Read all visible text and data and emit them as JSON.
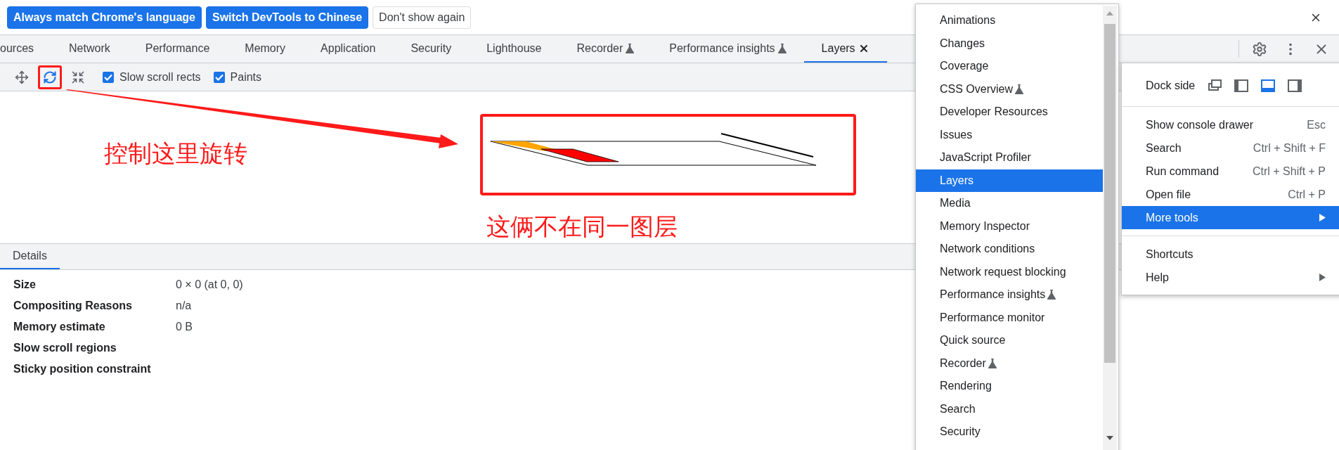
{
  "infobar": {
    "buttons": [
      {
        "label": "Always match Chrome's language",
        "kind": "primary"
      },
      {
        "label": "Switch DevTools to Chinese",
        "kind": "primary"
      },
      {
        "label": "Don't show again",
        "kind": "secondary"
      }
    ]
  },
  "tabs": [
    {
      "label": "ources",
      "selected": false,
      "experimental": false,
      "closable": false
    },
    {
      "label": "Network",
      "selected": false,
      "experimental": false,
      "closable": false
    },
    {
      "label": "Performance",
      "selected": false,
      "experimental": false,
      "closable": false
    },
    {
      "label": "Memory",
      "selected": false,
      "experimental": false,
      "closable": false
    },
    {
      "label": "Application",
      "selected": false,
      "experimental": false,
      "closable": false
    },
    {
      "label": "Security",
      "selected": false,
      "experimental": false,
      "closable": false
    },
    {
      "label": "Lighthouse",
      "selected": false,
      "experimental": false,
      "closable": false
    },
    {
      "label": "Recorder",
      "selected": false,
      "experimental": true,
      "closable": false
    },
    {
      "label": "Performance insights",
      "selected": false,
      "experimental": true,
      "closable": false
    },
    {
      "label": "Layers",
      "selected": true,
      "experimental": false,
      "closable": true
    }
  ],
  "toolbar": {
    "tools": [
      {
        "kind": "pan",
        "selected": false,
        "annotated": false
      },
      {
        "kind": "rotate",
        "selected": true,
        "annotated": true
      },
      {
        "kind": "reset",
        "selected": false,
        "annotated": false
      }
    ],
    "checkboxes": [
      {
        "label": "Slow scroll rects",
        "checked": true
      },
      {
        "label": "Paints",
        "checked": true
      }
    ]
  },
  "annotations": [
    {
      "text": "控制这里旋转"
    },
    {
      "text": "这俩不在同一图层"
    }
  ],
  "details": {
    "tab": {
      "label": "Details",
      "selected": true
    },
    "rows": [
      {
        "label": "Size",
        "value": "0 × 0 (at 0, 0)"
      },
      {
        "label": "Compositing Reasons",
        "value": "n/a"
      },
      {
        "label": "Memory estimate",
        "value": "0 B"
      },
      {
        "label": "Slow scroll regions"
      },
      {
        "label": "Sticky position constraint"
      }
    ]
  },
  "more_tools_menu": {
    "items": [
      {
        "label": "Animations",
        "experimental": false,
        "selected": false
      },
      {
        "label": "Changes",
        "experimental": false,
        "selected": false
      },
      {
        "label": "Coverage",
        "experimental": false,
        "selected": false
      },
      {
        "label": "CSS Overview",
        "experimental": true,
        "selected": false
      },
      {
        "label": "Developer Resources",
        "experimental": false,
        "selected": false
      },
      {
        "label": "Issues",
        "experimental": false,
        "selected": false
      },
      {
        "label": "JavaScript Profiler",
        "experimental": false,
        "selected": false
      },
      {
        "label": "Layers",
        "experimental": false,
        "selected": true
      },
      {
        "label": "Media",
        "experimental": false,
        "selected": false
      },
      {
        "label": "Memory Inspector",
        "experimental": false,
        "selected": false
      },
      {
        "label": "Network conditions",
        "experimental": false,
        "selected": false
      },
      {
        "label": "Network request blocking",
        "experimental": false,
        "selected": false
      },
      {
        "label": "Performance insights",
        "experimental": true,
        "selected": false
      },
      {
        "label": "Performance monitor",
        "experimental": false,
        "selected": false
      },
      {
        "label": "Quick source",
        "experimental": false,
        "selected": false
      },
      {
        "label": "Recorder",
        "experimental": true,
        "selected": false
      },
      {
        "label": "Rendering",
        "experimental": false,
        "selected": false
      },
      {
        "label": "Search",
        "experimental": false,
        "selected": false
      },
      {
        "label": "Security",
        "experimental": false,
        "selected": false
      }
    ]
  },
  "main_menu": {
    "dock_side": {
      "label": "Dock side",
      "options": [
        {
          "kind": "undock",
          "selected": false
        },
        {
          "kind": "left",
          "selected": false
        },
        {
          "kind": "bottom",
          "selected": true
        },
        {
          "kind": "right",
          "selected": false
        }
      ]
    },
    "sections": [
      [
        {
          "label": "Show console drawer",
          "shortcut": "Esc",
          "submenu": false,
          "selected": false
        },
        {
          "label": "Search",
          "shortcut": "Ctrl + Shift + F",
          "submenu": false,
          "selected": false
        },
        {
          "label": "Run command",
          "shortcut": "Ctrl + Shift + P",
          "submenu": false,
          "selected": false
        },
        {
          "label": "Open file",
          "shortcut": "Ctrl + P",
          "submenu": false,
          "selected": false
        },
        {
          "label": "More tools",
          "submenu": true,
          "selected": true
        }
      ],
      [
        {
          "label": "Shortcuts",
          "submenu": false,
          "selected": false
        },
        {
          "label": "Help",
          "submenu": true,
          "selected": false
        }
      ]
    ]
  }
}
